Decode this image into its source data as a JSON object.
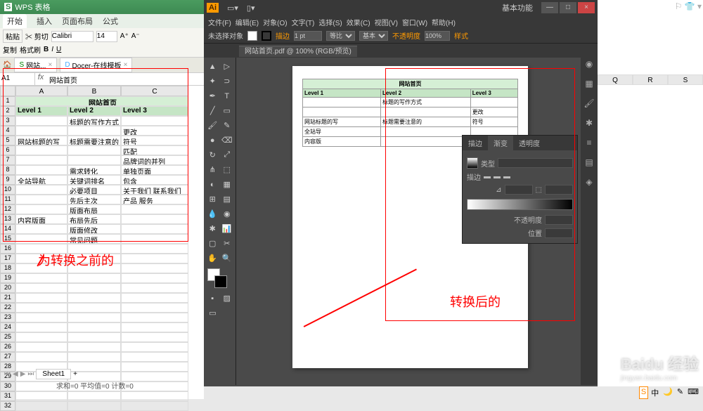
{
  "wps": {
    "app": "WPS 表格",
    "menu": [
      "开始",
      "插入",
      "页面布局",
      "公式"
    ],
    "clipboard": {
      "paste": "粘贴",
      "cut": "剪切",
      "copy": "复制",
      "format": "格式刷"
    },
    "font": {
      "name": "Calibri",
      "size": "14"
    },
    "tabs": [
      {
        "label": "网站..."
      },
      {
        "label": "Docer-在线模板"
      }
    ],
    "cellRef": "A1",
    "formulaContent": "网站首页",
    "cols": [
      "A",
      "B",
      "C"
    ],
    "data": {
      "title": "网站首页",
      "headers": [
        "Level 1",
        "Level 2",
        "Level 3"
      ],
      "rows": [
        [
          "",
          "标题的写作方式",
          ""
        ],
        [
          "",
          "",
          "更改"
        ],
        [
          "网站标题的写",
          "标题需要注意的",
          "符号"
        ],
        [
          "",
          "",
          "匹配"
        ],
        [
          "",
          "",
          "品牌词的并列"
        ],
        [
          "",
          "需求转化",
          "单独页面"
        ],
        [
          "全站导航",
          "关键词排名",
          "包含"
        ],
        [
          "",
          "必要项目",
          "关于我们 联系我们"
        ],
        [
          "",
          "先后主次",
          "产品 服务"
        ],
        [
          "",
          "版面布局",
          ""
        ],
        [
          "内容版面",
          "布局先后",
          ""
        ],
        [
          "",
          "版面修改",
          ""
        ],
        [
          "",
          "常见问题",
          ""
        ]
      ]
    },
    "sheetTab": "Sheet1",
    "statusBar": "求和=0   平均值=0   计数=0",
    "annotation1": "为转换之前的"
  },
  "ai": {
    "basicFunc": "基本功能",
    "menu": [
      "文件(F)",
      "编辑(E)",
      "对象(O)",
      "文字(T)",
      "选择(S)",
      "效果(C)",
      "视图(V)",
      "窗口(W)",
      "帮助(H)"
    ],
    "controlBar": {
      "noSel": "未选择对象",
      "stroke": "描边",
      "pt": "1 pt",
      "uniform": "等比",
      "basic": "基本",
      "opacity": "不透明度",
      "opval": "100%",
      "style": "样式"
    },
    "docTab": "网站首页.pdf @ 100% (RGB/预览)",
    "artboard": {
      "title": "网站首页",
      "headers": [
        "Level 1",
        "Level 2",
        "Level 3"
      ],
      "rows": [
        [
          "",
          "标题的写作方式",
          ""
        ],
        [
          "",
          "",
          "更改"
        ],
        [
          "网站标题的写",
          "标题需要注意的",
          "符号"
        ],
        [
          "全站导",
          "",
          ""
        ],
        [
          "内容版",
          "",
          ""
        ]
      ]
    },
    "gradPanel": {
      "tabs": [
        "描边",
        "渐变",
        "透明度"
      ],
      "typeLabel": "类型",
      "type": "▼",
      "strokeLabel": "描边",
      "opacityLabel": "不透明度",
      "posLabel": "位置"
    },
    "annotation2": "转换后的"
  },
  "rightCols": [
    "Q",
    "R",
    "S"
  ],
  "watermark": {
    "brand": "Baidu 经验",
    "url": "jingyan.baidu.com"
  }
}
